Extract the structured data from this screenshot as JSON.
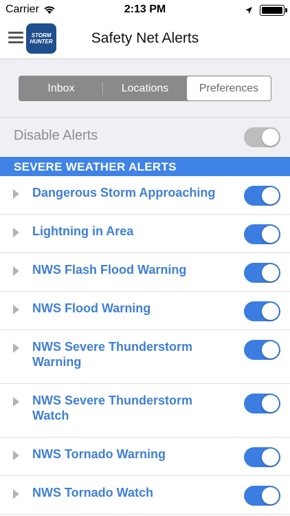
{
  "status_bar": {
    "carrier": "Carrier",
    "time": "2:13 PM"
  },
  "nav": {
    "title": "Safety Net Alerts",
    "logo_text": "STORM HUNTER"
  },
  "tabs": [
    {
      "label": "Inbox",
      "active": false
    },
    {
      "label": "Locations",
      "active": false
    },
    {
      "label": "Preferences",
      "active": true
    }
  ],
  "disable_alerts": {
    "label": "Disable Alerts",
    "enabled": false
  },
  "section": {
    "title": "SEVERE WEATHER ALERTS"
  },
  "alerts": [
    {
      "label": "Dangerous Storm Approaching",
      "on": true
    },
    {
      "label": "Lightning in Area",
      "on": true
    },
    {
      "label": "NWS Flash Flood Warning",
      "on": true
    },
    {
      "label": "NWS Flood Warning",
      "on": true
    },
    {
      "label": "NWS Severe Thunderstorm Warning",
      "on": true
    },
    {
      "label": "NWS Severe Thunderstorm Watch",
      "on": true
    },
    {
      "label": "NWS Tornado Warning",
      "on": true
    },
    {
      "label": "NWS Tornado Watch",
      "on": true
    }
  ],
  "colors": {
    "accent": "#3f83e6",
    "toggle_on": "#3b7de0",
    "link_text": "#3f7fd6"
  }
}
